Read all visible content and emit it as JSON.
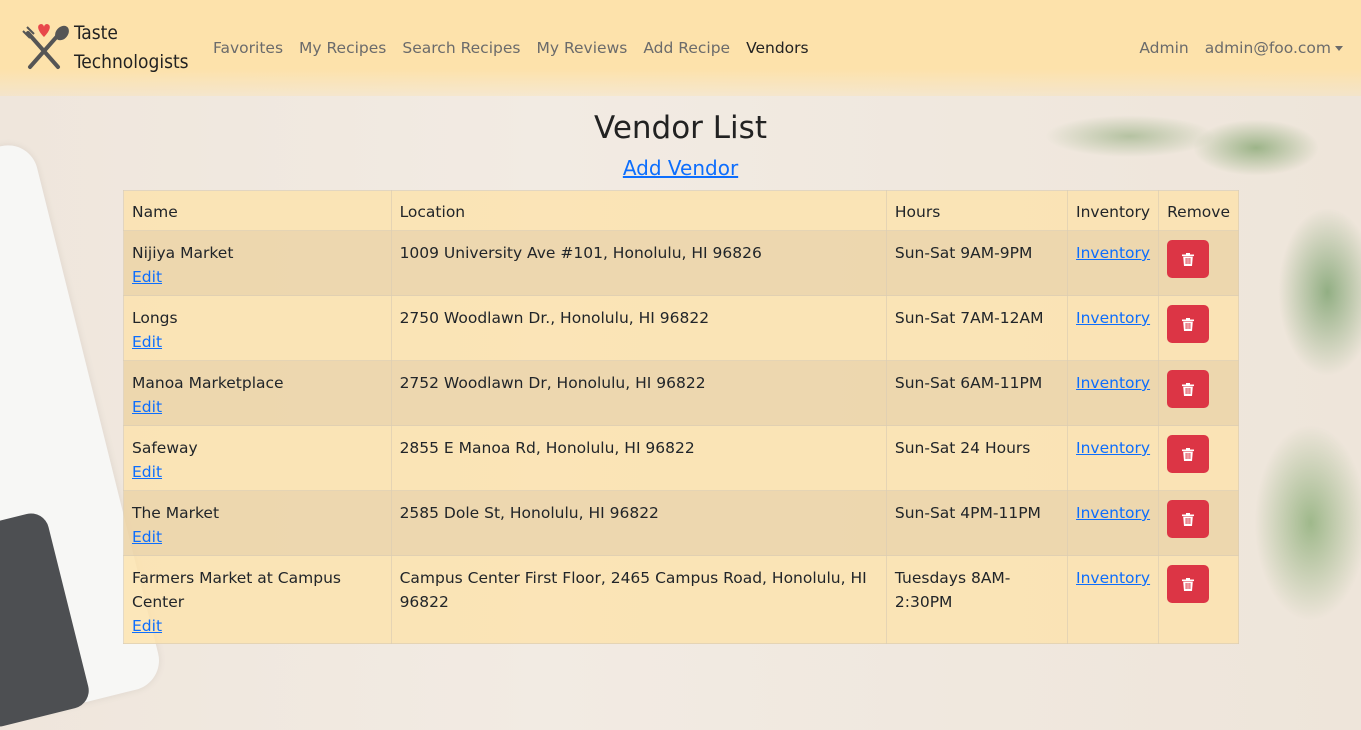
{
  "brand": {
    "line1": "Taste",
    "line2": "Technologists"
  },
  "nav": {
    "links": [
      "Favorites",
      "My Recipes",
      "Search Recipes",
      "My Reviews",
      "Add Recipe",
      "Vendors"
    ],
    "active": "Vendors",
    "admin": "Admin",
    "user": "admin@foo.com"
  },
  "page": {
    "title": "Vendor List",
    "add_vendor": "Add Vendor"
  },
  "table": {
    "headers": [
      "Name",
      "Location",
      "Hours",
      "Inventory",
      "Remove"
    ],
    "edit_label": "Edit",
    "inventory_label": "Inventory",
    "rows": [
      {
        "name": "Nijiya Market",
        "location": "1009 University Ave #101, Honolulu, HI 96826",
        "hours": "Sun-Sat 9AM-9PM"
      },
      {
        "name": "Longs",
        "location": "2750 Woodlawn Dr., Honolulu, HI 96822",
        "hours": "Sun-Sat 7AM-12AM"
      },
      {
        "name": "Manoa Marketplace",
        "location": "2752 Woodlawn Dr, Honolulu, HI 96822",
        "hours": "Sun-Sat 6AM-11PM"
      },
      {
        "name": "Safeway",
        "location": "2855 E Manoa Rd, Honolulu, HI 96822",
        "hours": "Sun-Sat 24 Hours"
      },
      {
        "name": "The Market",
        "location": "2585 Dole St, Honolulu, HI 96822",
        "hours": "Sun-Sat 4PM-11PM"
      },
      {
        "name": "Farmers Market at Campus Center",
        "location": "Campus Center First Floor, 2465 Campus Road, Honolulu, HI 96822",
        "hours": "Tuesdays 8AM-2:30PM"
      }
    ]
  },
  "colors": {
    "navbar": "#fde2ab",
    "link": "#0d6efd",
    "delete": "#dc3545"
  },
  "icons": {
    "logo": "fork-spoon-heart-icon",
    "delete": "trash-icon",
    "dropdown": "caret-down-icon"
  }
}
